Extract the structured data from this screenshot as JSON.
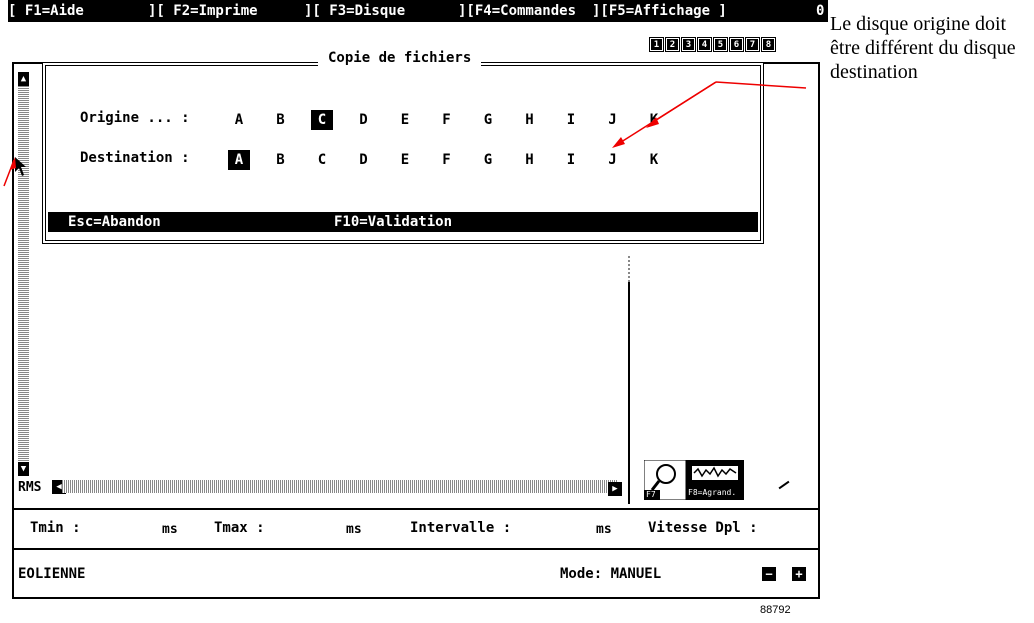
{
  "function_bar": {
    "f1": "[ F1=Aide",
    "f2": "][ F2=Imprime",
    "f3": "][ F3=Disque",
    "f4": "][F4=Commandes",
    "f5": "][F5=Affichage ]",
    "extra": "0"
  },
  "window_numbers": [
    "1",
    "2",
    "3",
    "4",
    "5",
    "6",
    "7",
    "8"
  ],
  "dialog": {
    "title": "Copie de fichiers",
    "origin_label": "Origine ... :",
    "destination_label": "Destination :",
    "drives": [
      "A",
      "B",
      "C",
      "D",
      "E",
      "F",
      "G",
      "H",
      "I",
      "J",
      "K"
    ],
    "origin_selected": "C",
    "destination_selected": "A",
    "esc_label": "Esc=Abandon",
    "f10_label": "F10=Validation"
  },
  "rms_label": "RMS",
  "icons": {
    "f7_label": "F7",
    "f8_label": "F8=Agrand.",
    "zoom_icon": "magnifier-icon",
    "enlarge_icon": "signal-expand-icon"
  },
  "status": {
    "tmin_label": "Tmin :",
    "tmin_unit": "ms",
    "tmax_label": "Tmax :",
    "tmax_unit": "ms",
    "interval_label": "Intervalle :",
    "interval_unit": "ms",
    "speed_label": "Vitesse Dpl :",
    "site": "EOLIENNE",
    "mode": "Mode: MANUEL"
  },
  "annotation": "Le disque origine doit être différent du disque destination",
  "figure_number": "88792"
}
